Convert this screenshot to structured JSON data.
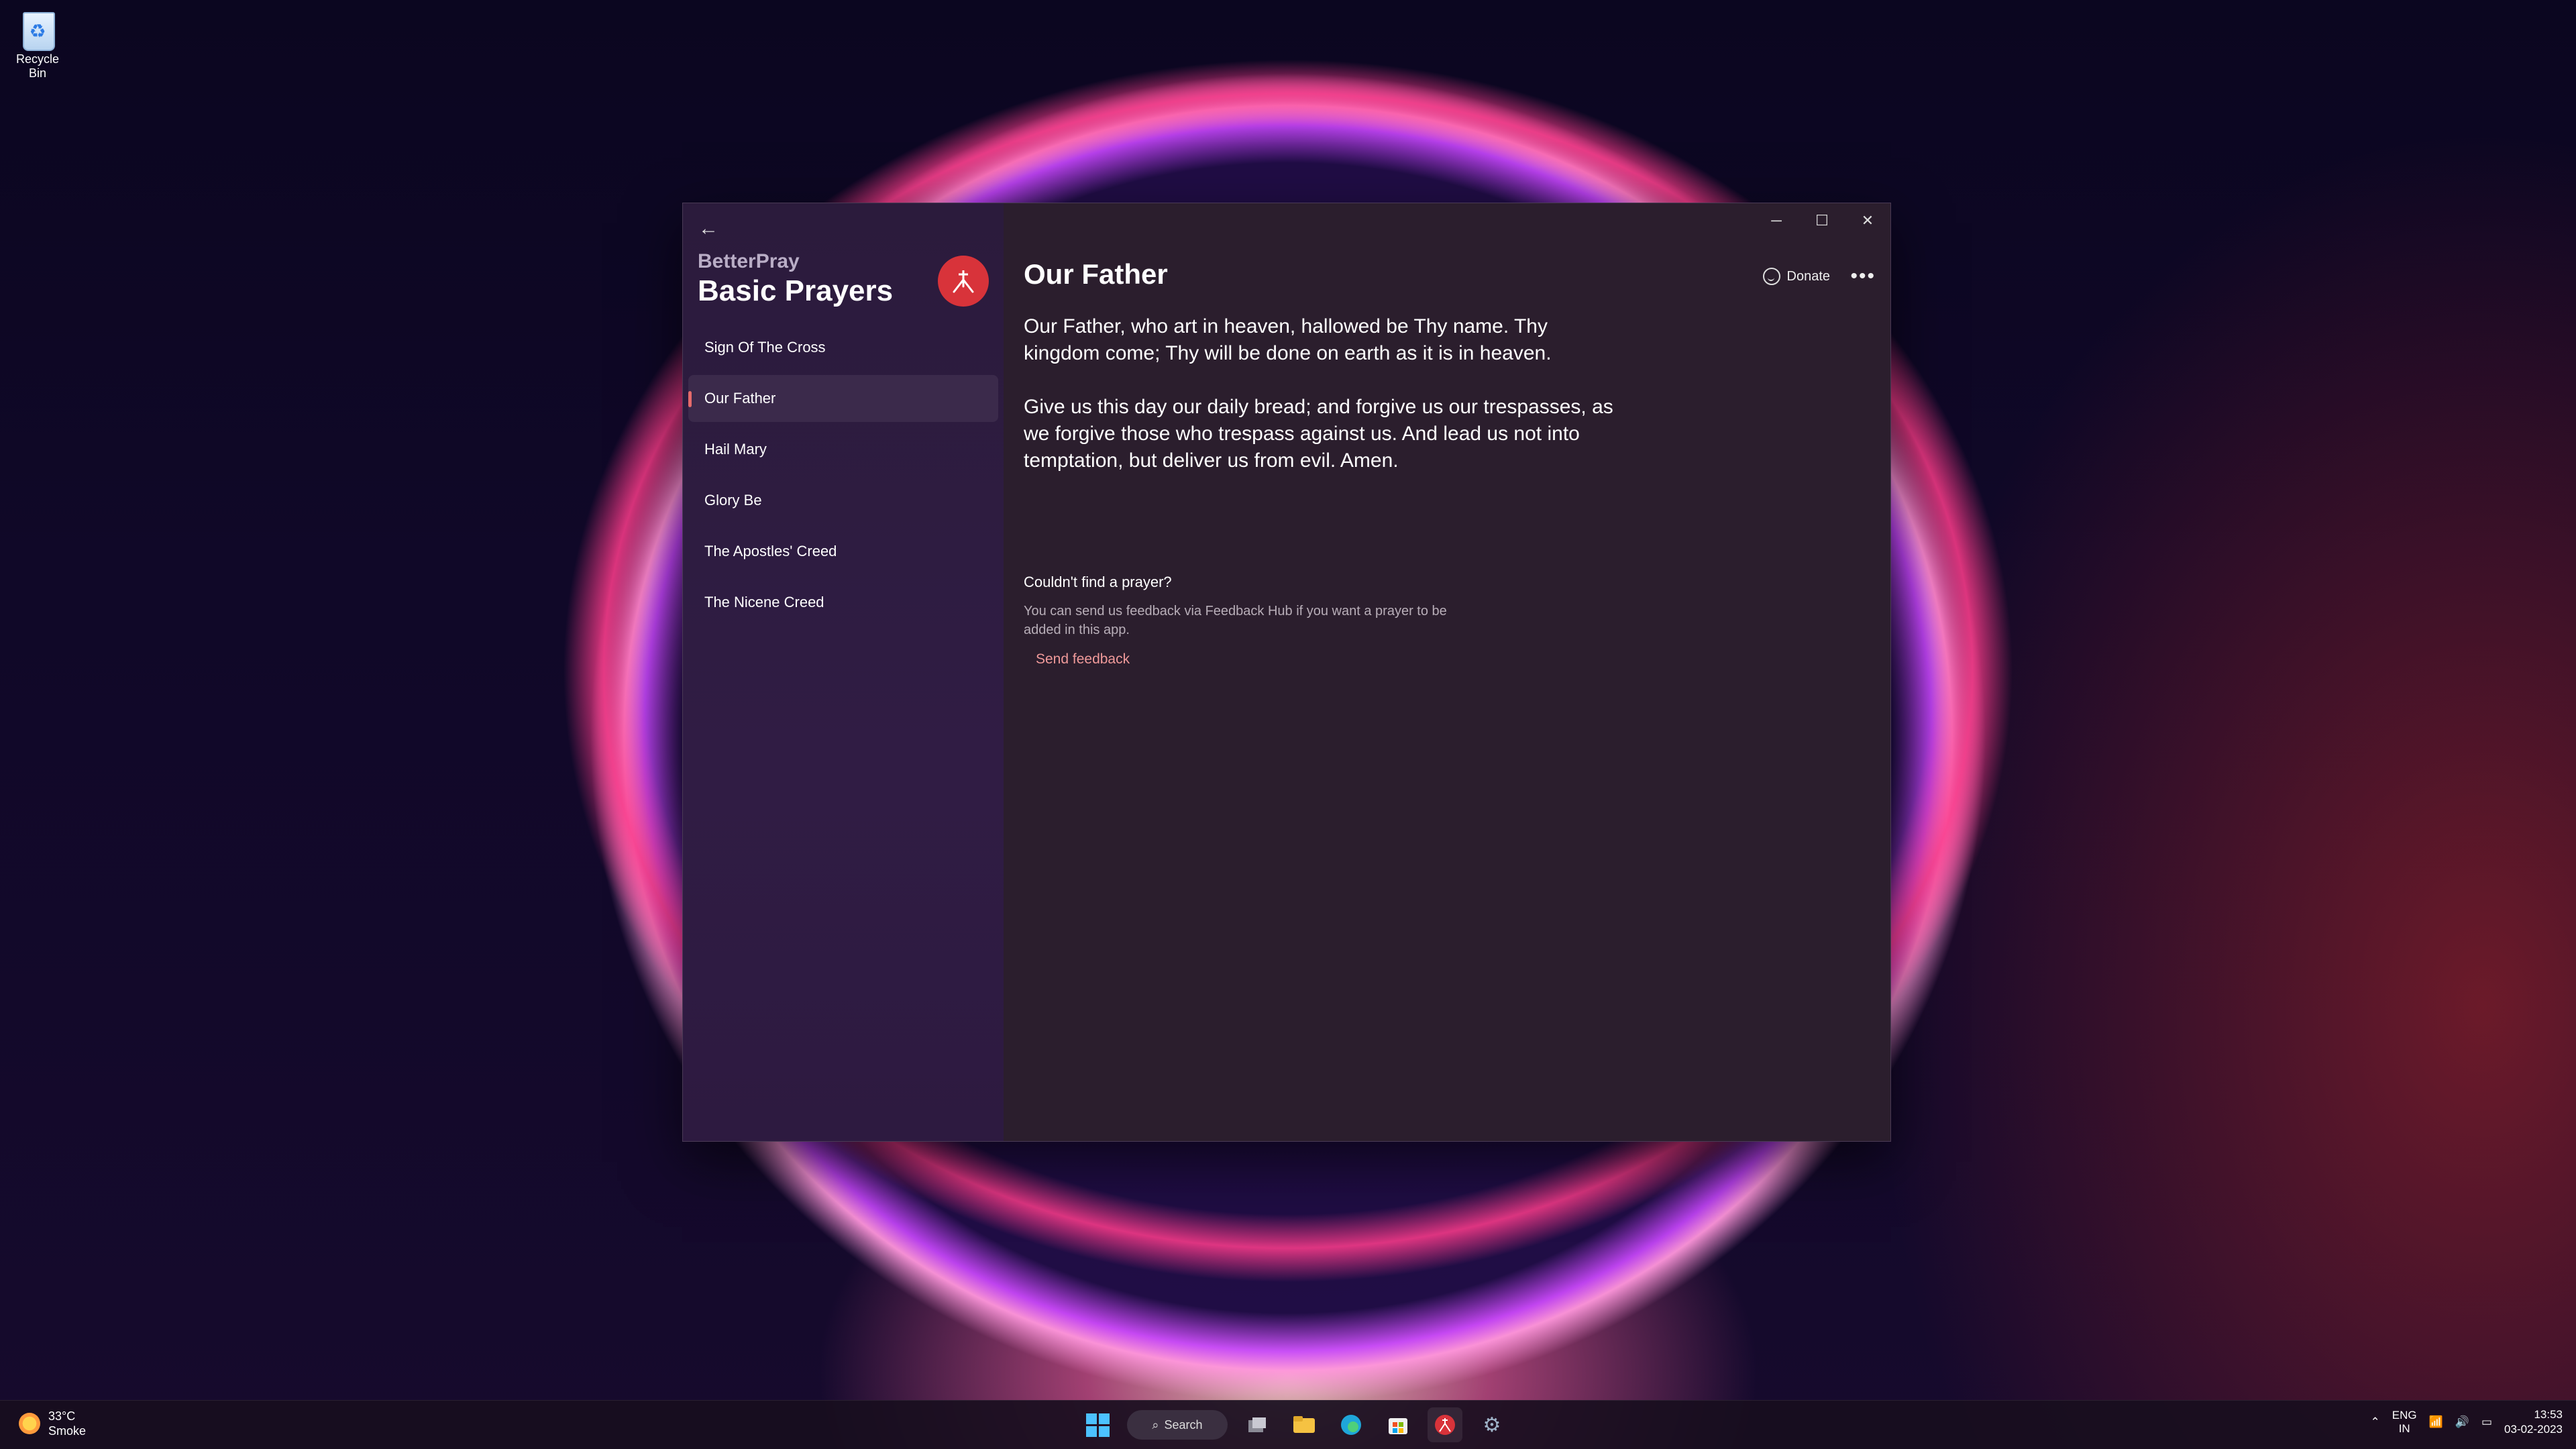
{
  "desktop": {
    "recycle_bin_label": "Recycle Bin"
  },
  "window": {
    "app_name": "BetterPray",
    "section_title": "Basic Prayers",
    "nav_items": [
      {
        "label": "Sign Of The Cross"
      },
      {
        "label": "Our Father"
      },
      {
        "label": "Hail Mary"
      },
      {
        "label": "Glory Be"
      },
      {
        "label": "The Apostles' Creed"
      },
      {
        "label": "The Nicene Creed"
      }
    ],
    "selected_item": "Our Father",
    "page_title": "Our Father",
    "donate_label": "Donate",
    "prayer_paragraphs": [
      "Our Father, who art in heaven, hallowed be Thy name. Thy kingdom come; Thy will be done on earth as it is in heaven.",
      "Give us this day our daily bread; and forgive us our trespasses, as we forgive those who trespass against us. And lead us not into temptation, but deliver us from evil. Amen."
    ],
    "feedback": {
      "title": "Couldn't find a prayer?",
      "text": "You can send us feedback via Feedback Hub if you want a prayer to be added in this app.",
      "link": "Send feedback"
    }
  },
  "taskbar": {
    "weather_temp": "33°C",
    "weather_desc": "Smoke",
    "search_label": "Search",
    "lang_line1": "ENG",
    "lang_line2": "IN",
    "time": "13:53",
    "date": "03-02-2023"
  },
  "colors": {
    "accent": "#e56b6b",
    "logo_red": "#d8333a",
    "link": "#f09a9a",
    "windows_blue": "#4cc2ff"
  }
}
